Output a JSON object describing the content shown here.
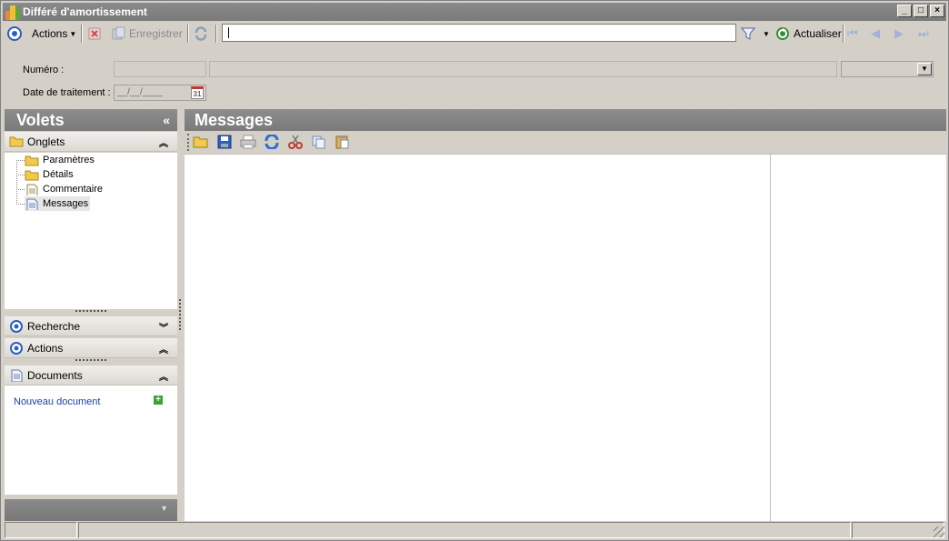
{
  "window": {
    "title": "Différé d'amortissement",
    "buttons": [
      "_",
      "□",
      "×"
    ]
  },
  "toolbar": {
    "actions_label": "Actions",
    "save_label": "Enregistrer",
    "search_value": "",
    "refresh_label": "Actualiser"
  },
  "form": {
    "numero_label": "Numéro :",
    "date_label": "Date de traitement :",
    "date_placeholder": "__/__/____",
    "calendar_day": "31"
  },
  "left_pane": {
    "title": "Volets",
    "collapse_glyph": "«",
    "tabs_section": "Onglets",
    "tree_items": [
      "Paramètres",
      "Détails",
      "Commentaire",
      "Messages"
    ],
    "search_section": "Recherche",
    "actions_section": "Actions",
    "documents_section": "Documents",
    "new_document_link": "Nouveau document"
  },
  "main": {
    "title": "Messages"
  }
}
